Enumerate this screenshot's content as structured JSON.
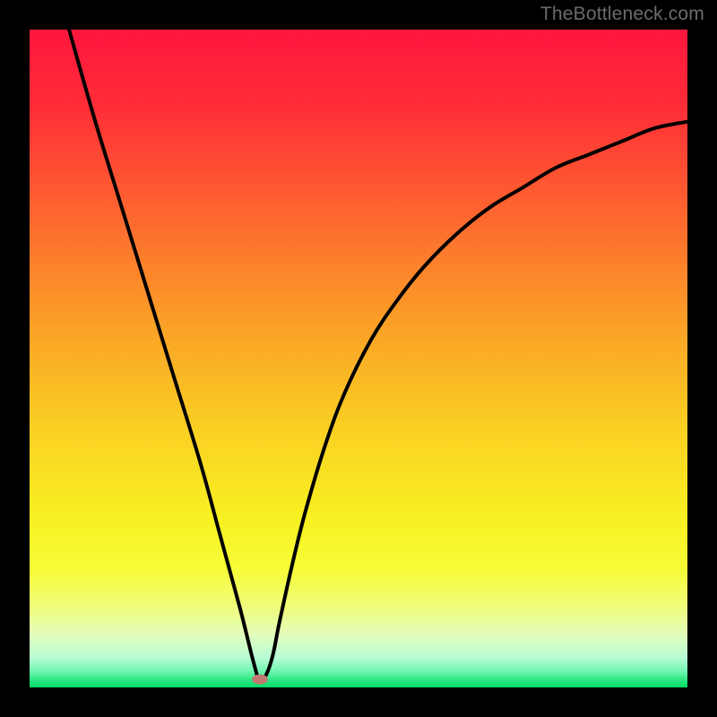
{
  "watermark": {
    "text": "TheBottleneck.com"
  },
  "colors": {
    "black": "#000000",
    "curve": "#000000",
    "marker": "#c17a71",
    "gradient_stops": [
      {
        "offset": 0.0,
        "color": "#ff163e"
      },
      {
        "offset": 0.12,
        "color": "#ff2e37"
      },
      {
        "offset": 0.3,
        "color": "#fd6d2e"
      },
      {
        "offset": 0.45,
        "color": "#fba127"
      },
      {
        "offset": 0.6,
        "color": "#face23"
      },
      {
        "offset": 0.74,
        "color": "#f8f022"
      },
      {
        "offset": 0.82,
        "color": "#f6fc36"
      },
      {
        "offset": 0.88,
        "color": "#effd7e"
      },
      {
        "offset": 0.92,
        "color": "#e2fdbc"
      },
      {
        "offset": 0.955,
        "color": "#b8fcd5"
      },
      {
        "offset": 0.975,
        "color": "#72f6b2"
      },
      {
        "offset": 0.99,
        "color": "#26e67e"
      },
      {
        "offset": 1.0,
        "color": "#06db68"
      }
    ]
  },
  "chart_data": {
    "type": "line",
    "title": "",
    "xlabel": "",
    "ylabel": "",
    "xlim": [
      0,
      100
    ],
    "ylim": [
      0,
      100
    ],
    "grid": false,
    "legend": false,
    "annotations": [],
    "marker": {
      "x": 35,
      "y": 1.2
    },
    "series": [
      {
        "name": "curve",
        "x": [
          6,
          10,
          14,
          18,
          22,
          26,
          29,
          32,
          34,
          35,
          36,
          37,
          38,
          40,
          42,
          45,
          48,
          52,
          56,
          60,
          65,
          70,
          75,
          80,
          85,
          90,
          95,
          100
        ],
        "y": [
          100,
          86,
          73,
          60,
          47,
          34,
          23,
          12,
          4,
          1,
          2,
          5,
          10,
          19,
          27,
          37,
          45,
          53,
          59,
          64,
          69,
          73,
          76,
          79,
          81,
          83,
          85,
          86
        ]
      }
    ]
  }
}
